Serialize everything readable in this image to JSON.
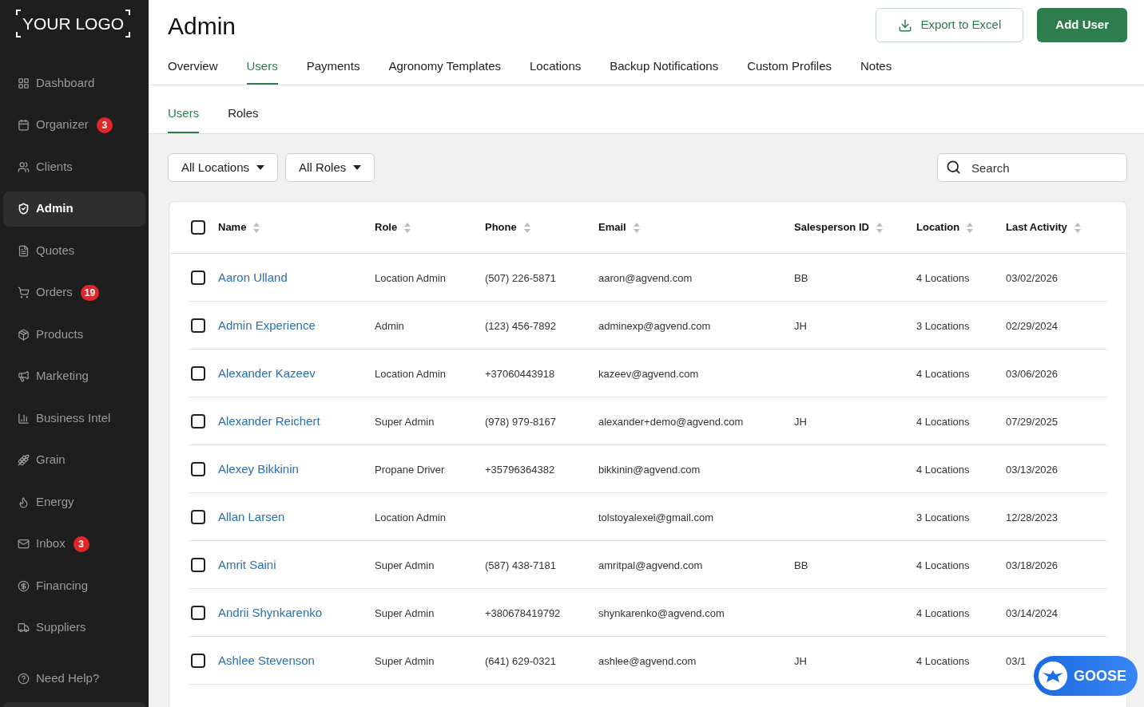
{
  "sidebar": {
    "logo": "YOUR LOGO",
    "items": [
      {
        "label": "Dashboard",
        "selected": false
      },
      {
        "label": "Organizer",
        "badge": "3",
        "selected": false
      },
      {
        "label": "Clients",
        "selected": false
      },
      {
        "label": "Admin",
        "selected": true
      },
      {
        "label": "Quotes",
        "selected": false
      },
      {
        "label": "Orders",
        "badge": "19",
        "selected": false
      },
      {
        "label": "Products",
        "selected": false
      },
      {
        "label": "Marketing",
        "selected": false
      },
      {
        "label": "Business Intel",
        "selected": false
      },
      {
        "label": "Grain",
        "selected": false
      },
      {
        "label": "Energy",
        "selected": false
      },
      {
        "label": "Inbox",
        "badge": "3",
        "selected": false
      },
      {
        "label": "Financing",
        "selected": false
      },
      {
        "label": "Suppliers",
        "selected": false
      }
    ],
    "help": {
      "label": "Need Help?"
    }
  },
  "header": {
    "title": "Admin",
    "actions": [
      {
        "label": "Export to Excel",
        "kind": "outline"
      },
      {
        "label": "Add User",
        "kind": "primary"
      }
    ],
    "tabs": [
      {
        "label": "Overview",
        "selected": false
      },
      {
        "label": "Users",
        "selected": true
      },
      {
        "label": "Payments",
        "selected": false
      },
      {
        "label": "Agronomy Templates",
        "selected": false
      },
      {
        "label": "Locations",
        "selected": false
      },
      {
        "label": "Backup Notifications",
        "selected": false
      },
      {
        "label": "Custom Profiles",
        "selected": false
      },
      {
        "label": "Notes",
        "selected": false
      }
    ]
  },
  "subtabs": [
    {
      "label": "Users",
      "selected": true
    },
    {
      "label": "Roles",
      "selected": false
    }
  ],
  "filters": [
    {
      "label": "All Locations"
    },
    {
      "label": "All Roles"
    }
  ],
  "search": {
    "placeholder": "Search"
  },
  "table": {
    "select_all": {
      "checked": false
    },
    "columns": [
      "Name",
      "Role",
      "Phone",
      "Email",
      "Salesperson ID",
      "Location",
      "Last Activity"
    ],
    "rows": [
      {
        "checked": false,
        "name": "Aaron Ulland",
        "role": "Location Admin",
        "phone": "(507) 226-5871",
        "email": "aaron@agvend.com",
        "salesperson_id": "BB",
        "location": "4 Locations",
        "last_activity": "03/02/2026"
      },
      {
        "checked": false,
        "name": "Admin Experience",
        "role": "Admin",
        "phone": "(123) 456-7892",
        "email": "adminexp@agvend.com",
        "salesperson_id": "JH",
        "location": "3 Locations",
        "last_activity": "02/29/2024"
      },
      {
        "checked": false,
        "name": "Alexander Kazeev",
        "role": "Location Admin",
        "phone": "+37060443918",
        "email": "kazeev@agvend.com",
        "location": "4 Locations",
        "last_activity": "03/06/2026"
      },
      {
        "checked": false,
        "name": "Alexander Reichert",
        "role": "Super Admin",
        "phone": "(978) 979-8167",
        "email": "alexander+demo@agvend.com",
        "salesperson_id": "JH",
        "location": "4 Locations",
        "last_activity": "07/29/2025"
      },
      {
        "checked": false,
        "name": "Alexey Bikkinin",
        "role": "Propane Driver",
        "phone": "+35796364382",
        "email": "bikkinin@agvend.com",
        "location": "4 Locations",
        "last_activity": "03/13/2026"
      },
      {
        "checked": false,
        "name": "Allan Larsen",
        "role": "Location Admin",
        "email": "tolstoyalexei@gmail.com",
        "location": "3 Locations",
        "last_activity": "12/28/2023"
      },
      {
        "checked": false,
        "name": "Amrit Saini",
        "role": "Super Admin",
        "phone": "(587) 438-7181",
        "email": "amritpal@agvend.com",
        "salesperson_id": "BB",
        "location": "4 Locations",
        "last_activity": "03/18/2026"
      },
      {
        "checked": false,
        "name": "Andrii Shynkarenko",
        "role": "Super Admin",
        "phone": "+380678419792",
        "email": "shynkarenko@agvend.com",
        "location": "4 Locations",
        "last_activity": "03/14/2024"
      },
      {
        "checked": false,
        "name": "Ashlee Stevenson",
        "role": "Super Admin",
        "phone": "(641) 629-0321",
        "email": "ashlee@agvend.com",
        "salesperson_id": "JH",
        "location": "4 Locations",
        "last_activity": "03/1"
      }
    ]
  },
  "assistant_button": {
    "label": "GOOSE"
  }
}
